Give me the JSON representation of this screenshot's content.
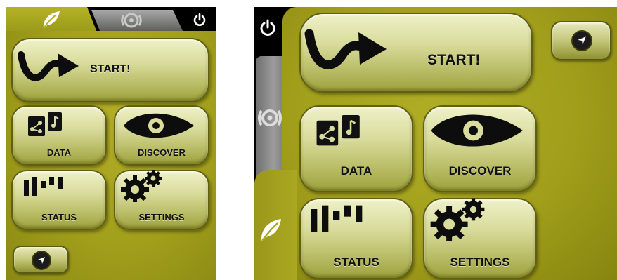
{
  "portrait": {
    "buttons": {
      "start": "START!",
      "data": "DATA",
      "discover": "DISCOVER",
      "status": "STATUS",
      "settings": "SETTINGS"
    },
    "icons": {
      "leaf_tab": "leaf-icon",
      "wheel_tab": "wheel-icon",
      "power": "power-icon",
      "navigate": "navigation-arrow-icon"
    }
  },
  "landscape": {
    "buttons": {
      "start": "START!",
      "data": "DATA",
      "discover": "DISCOVER",
      "status": "STATUS",
      "settings": "SETTINGS"
    },
    "icons": {
      "power": "power-icon",
      "wheel_tab": "wheel-icon",
      "leaf_tab": "leaf-icon",
      "navigate": "navigation-arrow-icon"
    }
  },
  "colors": {
    "panel_green": "#a29f1c",
    "button_face": "#d9dc9c",
    "tab_grey": "#8a8a8a",
    "frame": "#000000"
  }
}
